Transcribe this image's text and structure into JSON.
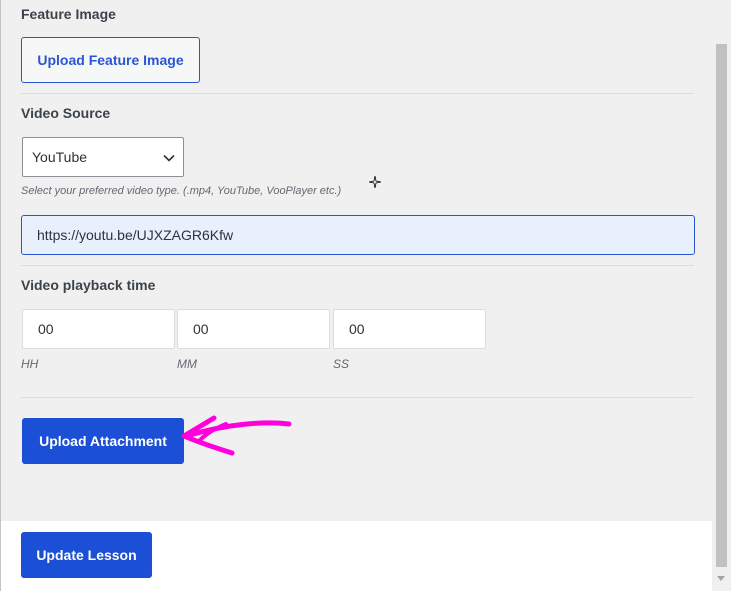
{
  "feature_image": {
    "label": "Feature Image",
    "upload_button": "Upload Feature Image"
  },
  "video_source": {
    "label": "Video Source",
    "selected": "YouTube",
    "help_text": "Select your preferred video type. (.mp4, YouTube, VooPlayer etc.)",
    "url_value": "https://youtu.be/UJXZAGR6Kfw"
  },
  "playback_time": {
    "label": "Video playback time",
    "fields": [
      {
        "value": "00",
        "unit": "HH"
      },
      {
        "value": "00",
        "unit": "MM"
      },
      {
        "value": "00",
        "unit": "SS"
      }
    ]
  },
  "attachment": {
    "upload_button": "Upload Attachment"
  },
  "footer": {
    "update_button": "Update Lesson"
  },
  "colors": {
    "primary": "#1a4fd6",
    "annotation": "#ff00dd"
  }
}
